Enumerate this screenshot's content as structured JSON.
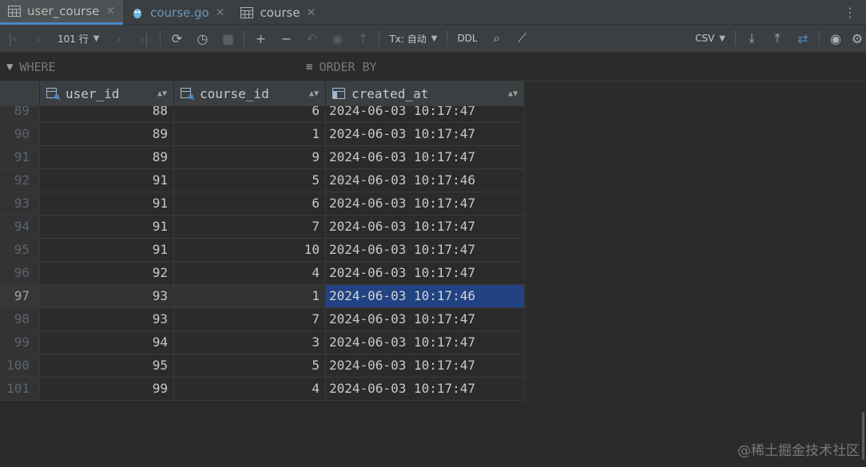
{
  "tabs": [
    {
      "label": "user_course",
      "icon": "table-icon",
      "active": true
    },
    {
      "label": "course.go",
      "icon": "gopher-file-icon",
      "active": false
    },
    {
      "label": "course",
      "icon": "table-icon",
      "active": false
    }
  ],
  "toolbar": {
    "row_count": "101 行",
    "tx_mode": "Tx: 自动",
    "ddl": "DDL",
    "export_format": "CSV"
  },
  "filter": {
    "where_label": "WHERE",
    "order_label": "ORDER BY"
  },
  "columns": [
    "user_id",
    "course_id",
    "created_at"
  ],
  "rows": [
    {
      "n": "89",
      "user_id": "88",
      "course_id": "6",
      "created_at": "2024-06-03 10:17:47"
    },
    {
      "n": "90",
      "user_id": "89",
      "course_id": "1",
      "created_at": "2024-06-03 10:17:47"
    },
    {
      "n": "91",
      "user_id": "89",
      "course_id": "9",
      "created_at": "2024-06-03 10:17:47"
    },
    {
      "n": "92",
      "user_id": "91",
      "course_id": "5",
      "created_at": "2024-06-03 10:17:46"
    },
    {
      "n": "93",
      "user_id": "91",
      "course_id": "6",
      "created_at": "2024-06-03 10:17:47"
    },
    {
      "n": "94",
      "user_id": "91",
      "course_id": "7",
      "created_at": "2024-06-03 10:17:47"
    },
    {
      "n": "95",
      "user_id": "91",
      "course_id": "10",
      "created_at": "2024-06-03 10:17:47"
    },
    {
      "n": "96",
      "user_id": "92",
      "course_id": "4",
      "created_at": "2024-06-03 10:17:47"
    },
    {
      "n": "97",
      "user_id": "93",
      "course_id": "1",
      "created_at": "2024-06-03 10:17:46"
    },
    {
      "n": "98",
      "user_id": "93",
      "course_id": "7",
      "created_at": "2024-06-03 10:17:47"
    },
    {
      "n": "99",
      "user_id": "94",
      "course_id": "3",
      "created_at": "2024-06-03 10:17:47"
    },
    {
      "n": "100",
      "user_id": "95",
      "course_id": "5",
      "created_at": "2024-06-03 10:17:47"
    },
    {
      "n": "101",
      "user_id": "99",
      "course_id": "4",
      "created_at": "2024-06-03 10:17:47"
    }
  ],
  "selection": {
    "row": 8,
    "column": "created_at"
  },
  "watermark": "@稀土掘金技术社区",
  "colors": {
    "accent": "#4a88c7",
    "selection": "#214283",
    "background": "#2b2b2b"
  }
}
